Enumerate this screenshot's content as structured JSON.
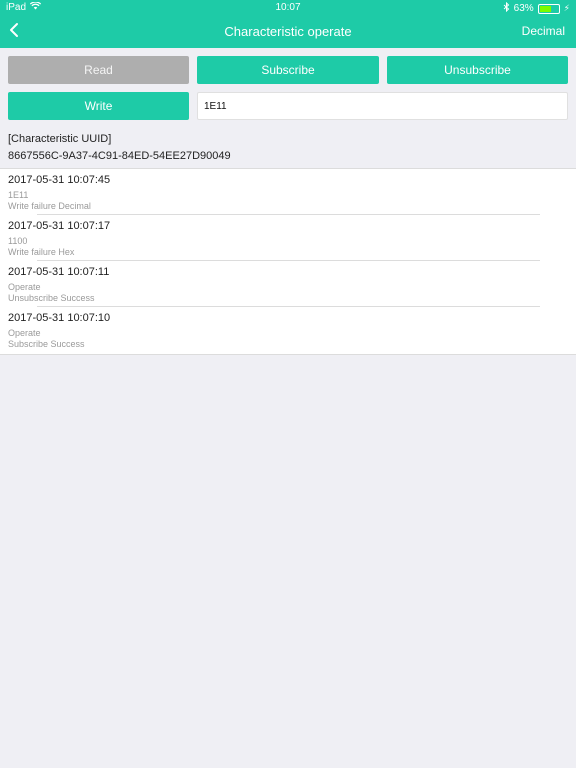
{
  "status_bar": {
    "carrier": "iPad",
    "time": "10:07",
    "battery": "63%",
    "battery_level": 0.63
  },
  "navbar": {
    "title": "Characteristic operate",
    "right_label": "Decimal"
  },
  "actions": {
    "read_label": "Read",
    "subscribe_label": "Subscribe",
    "unsubscribe_label": "Unsubscribe",
    "write_label": "Write",
    "write_value": "1E11"
  },
  "characteristic": {
    "heading": "[Characteristic UUID]",
    "uuid": "8667556C-9A37-4C91-84ED-54EE27D90049"
  },
  "logs": [
    {
      "timestamp": "2017-05-31 10:07:45",
      "line1": "1E11",
      "line2": "Write failure  Decimal"
    },
    {
      "timestamp": "2017-05-31 10:07:17",
      "line1": "1100",
      "line2": "Write failure  Hex"
    },
    {
      "timestamp": "2017-05-31 10:07:11",
      "line1": "Operate",
      "line2": "Unsubscribe Success"
    },
    {
      "timestamp": "2017-05-31 10:07:10",
      "line1": "Operate",
      "line2": "Subscribe Success"
    }
  ]
}
